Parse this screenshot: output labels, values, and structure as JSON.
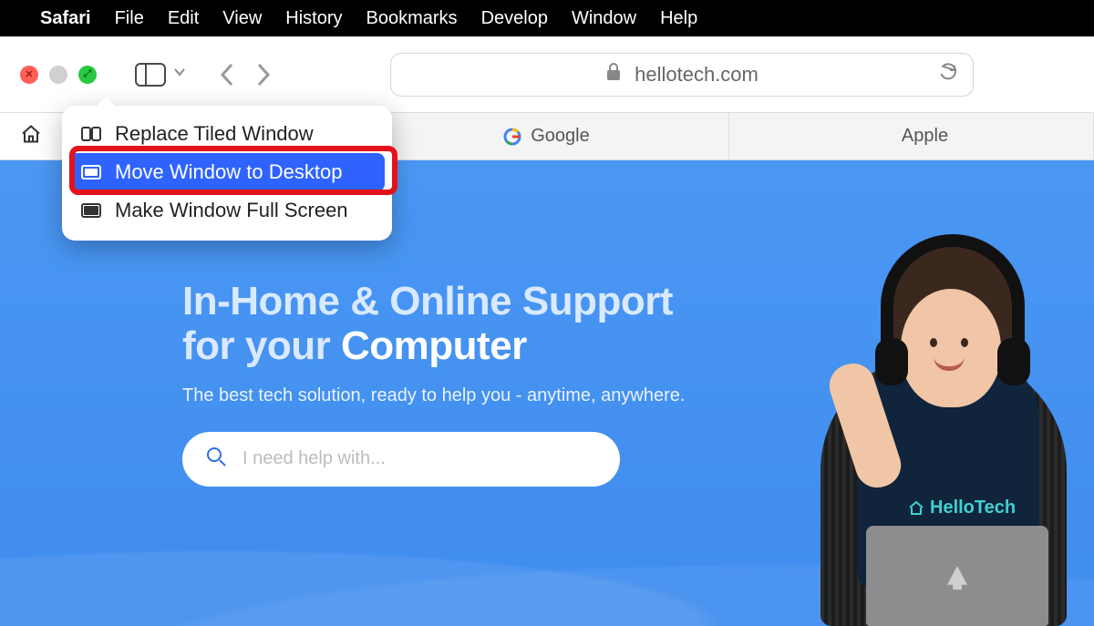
{
  "menubar": {
    "app": "Safari",
    "items": [
      "File",
      "Edit",
      "View",
      "History",
      "Bookmarks",
      "Develop",
      "Window",
      "Help"
    ]
  },
  "addressbar": {
    "domain": "hellotech.com"
  },
  "tabs": [
    {
      "label": "",
      "favicon": "home"
    },
    {
      "label": "Google",
      "favicon": "google"
    },
    {
      "label": "Apple",
      "favicon": "apple"
    }
  ],
  "green_menu": {
    "items": [
      {
        "label": "Replace Tiled Window",
        "selected": false
      },
      {
        "label": "Move Window to Desktop",
        "selected": true
      },
      {
        "label": "Make Window Full Screen",
        "selected": false
      }
    ]
  },
  "hero": {
    "line1": "In-Home & Online Support",
    "line2_prefix": "for your ",
    "line2_strong": "Computer",
    "sub": "The best tech solution, ready to help you - anytime, anywhere.",
    "search_placeholder": "I need help with..."
  },
  "shirt_brand": "HelloTech"
}
